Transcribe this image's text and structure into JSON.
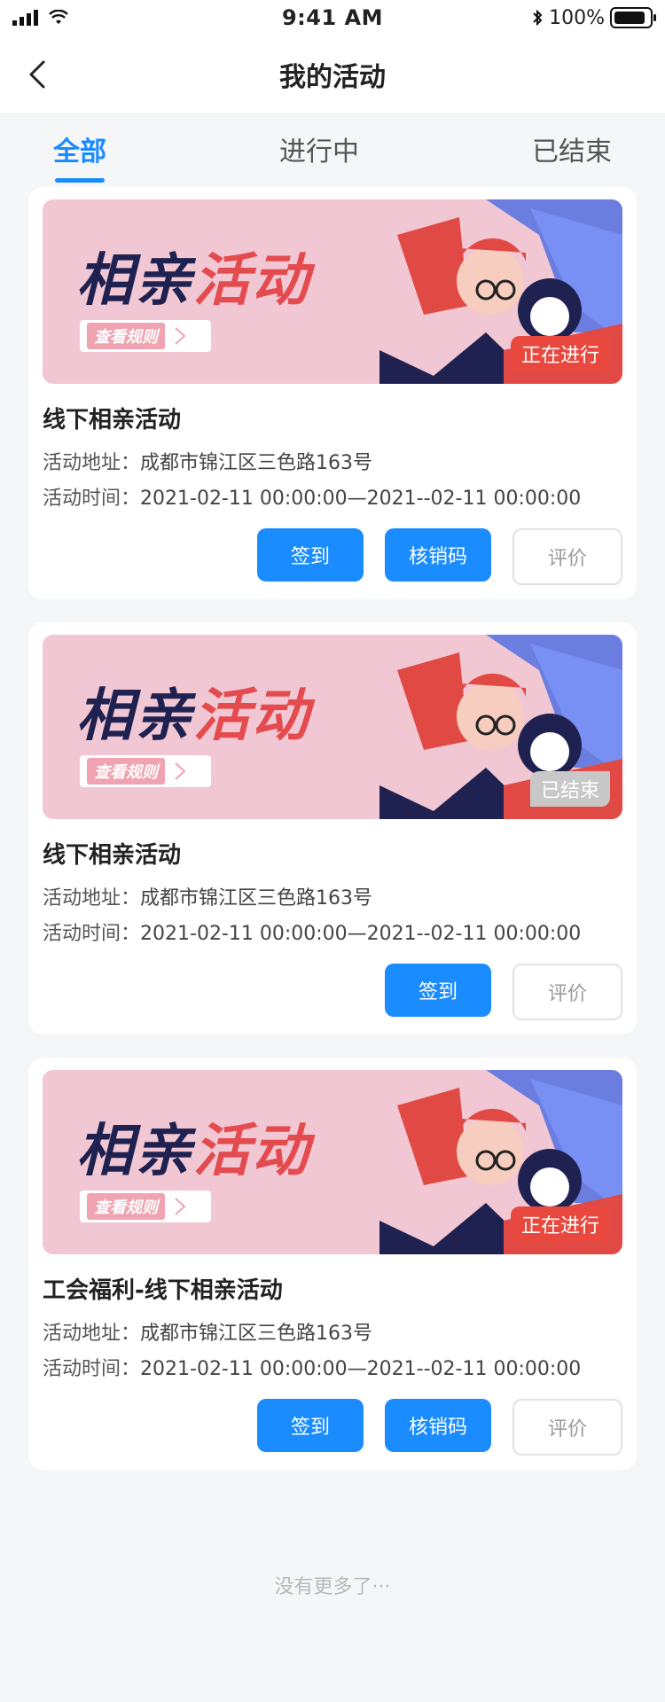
{
  "status": {
    "time": "9:41 AM",
    "battery": "100%"
  },
  "nav": {
    "title": "我的活动"
  },
  "tabs": [
    {
      "label": "全部",
      "active": true
    },
    {
      "label": "进行中",
      "active": false
    },
    {
      "label": "已结束",
      "active": false
    }
  ],
  "banner": {
    "title_dark": "相亲",
    "title_red": "活动",
    "rule": "查看规则"
  },
  "cards": [
    {
      "status_tag": "正在进行",
      "title": "线下相亲活动",
      "address_label": "活动地址：",
      "address": "成都市锦江区三色路163号",
      "time_label": "活动时间：",
      "time": "2021-02-11 00:00:00—2021--02-11 00:00:00",
      "actions": [
        "签到",
        "核销码",
        "评价"
      ]
    },
    {
      "status_tag": "已结束",
      "title": "线下相亲活动",
      "address_label": "活动地址：",
      "address": "成都市锦江区三色路163号",
      "time_label": "活动时间：",
      "time": "2021-02-11 00:00:00—2021--02-11 00:00:00",
      "actions": [
        "签到",
        "评价"
      ]
    },
    {
      "status_tag": "正在进行",
      "title": "工会福利-线下相亲活动",
      "address_label": "活动地址：",
      "address": "成都市锦江区三色路163号",
      "time_label": "活动时间：",
      "time": "2021-02-11 00:00:00—2021--02-11 00:00:00",
      "actions": [
        "签到",
        "核销码",
        "评价"
      ]
    }
  ],
  "footer": {
    "hint": "没有更多了···"
  },
  "colors": {
    "primary": "#1a8cff",
    "active_tag": "#e8483e",
    "ended_tag": "#c8c8c8"
  }
}
